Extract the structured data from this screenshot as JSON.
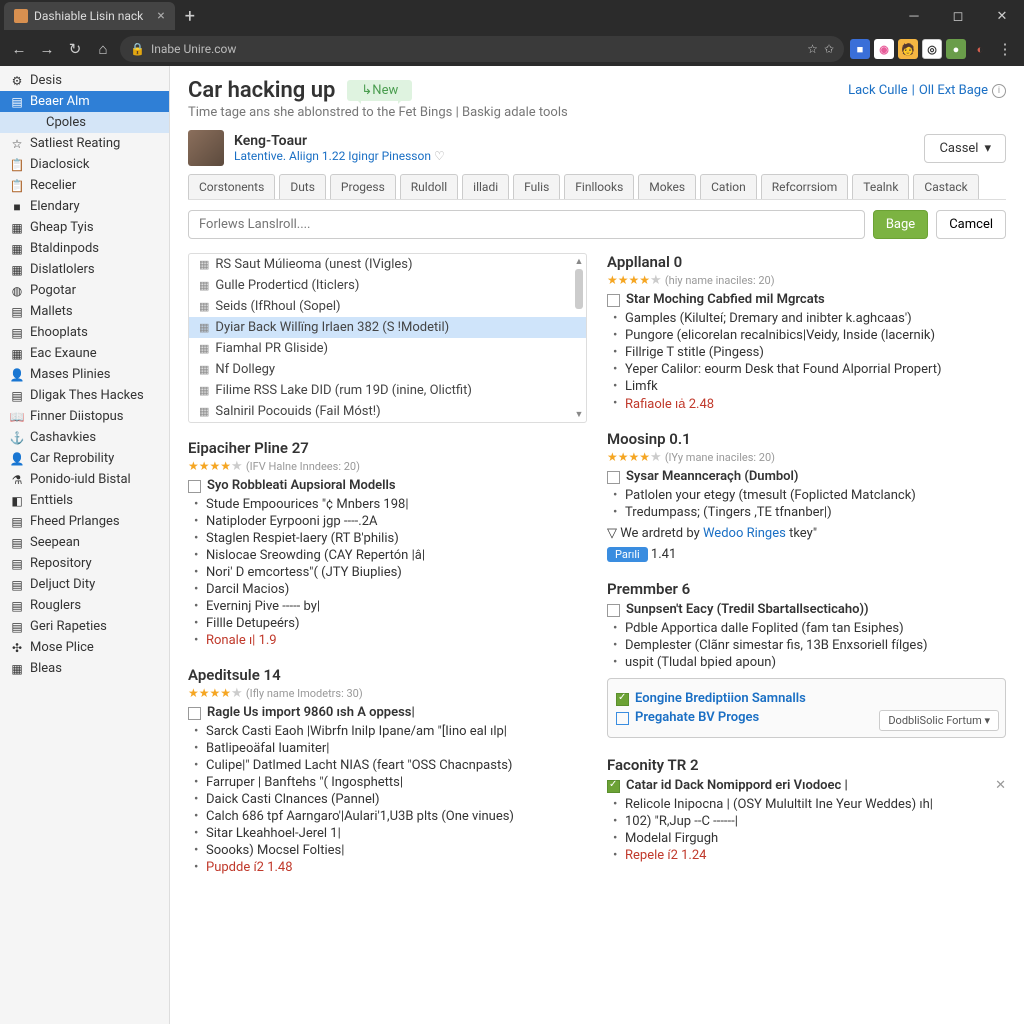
{
  "browser": {
    "tab_title": "Dashiable Lisin nack",
    "url": "Inabe Unire.cow",
    "ext_colors": [
      "#3a6fd8",
      "#e85d9a",
      "#f5b642",
      "#fff",
      "#6a9d4a",
      "#d8604f"
    ]
  },
  "sidebar": {
    "items": [
      {
        "icon": "⚙",
        "label": "Desis"
      },
      {
        "icon": "▤",
        "label": "Beaer Alm",
        "active": true
      },
      {
        "icon": "",
        "label": "Cpoles",
        "sub": true
      },
      {
        "icon": "☆",
        "label": "Satliest Reating"
      },
      {
        "icon": "📋",
        "label": "Diaclosick"
      },
      {
        "icon": "📋",
        "label": "Recelier"
      },
      {
        "icon": "■",
        "label": "Elendary"
      },
      {
        "icon": "▦",
        "label": "Gheap Tyis"
      },
      {
        "icon": "▦",
        "label": "Btaldinpods"
      },
      {
        "icon": "▦",
        "label": "Dislatlolers"
      },
      {
        "icon": "◍",
        "label": "Pogotar"
      },
      {
        "icon": "▤",
        "label": "Mallets"
      },
      {
        "icon": "▤",
        "label": "Ehooplats"
      },
      {
        "icon": "▦",
        "label": "Eac Exaune"
      },
      {
        "icon": "👤",
        "label": "Mases Plinies"
      },
      {
        "icon": "▤",
        "label": "Dligak Thes Hackes"
      },
      {
        "icon": "📖",
        "label": "Finner Diistopus"
      },
      {
        "icon": "⚓",
        "label": "Cashavkies"
      },
      {
        "icon": "👤",
        "label": "Car Reprobility"
      },
      {
        "icon": "⚗",
        "label": "Ponido-iuld Bistal"
      },
      {
        "icon": "◧",
        "label": "Enttiels"
      },
      {
        "icon": "▤",
        "label": "Fheed Prlanges"
      },
      {
        "icon": "▤",
        "label": "Seepean"
      },
      {
        "icon": "▤",
        "label": "Repository"
      },
      {
        "icon": "▤",
        "label": "Deljuct Dity"
      },
      {
        "icon": "▤",
        "label": "Rouglers"
      },
      {
        "icon": "▤",
        "label": "Geri Rapeties"
      },
      {
        "icon": "✣",
        "label": "Mose Plice"
      },
      {
        "icon": "▦",
        "label": "Bleas"
      }
    ]
  },
  "header": {
    "title": "Car hacking up",
    "badge": "↳New",
    "links": [
      "Lack Culle",
      "Oll Ext Bage"
    ],
    "subtitle": "Time tage ans she ablonstred to the Fet Bings | Baskig adale tools"
  },
  "author": {
    "name": "Keng-Toaur",
    "sub": "Latentive. Aliign 1.22 Igingr Pinesson",
    "dropdown": "Cassel"
  },
  "tabs": [
    "Corstonents",
    "Duts",
    "Progess",
    "Ruldoll",
    "illadi",
    "Fulis",
    "Finllooks",
    "Mokes",
    "Cation",
    "Refcorrsiom",
    "Tealnk",
    "Castack"
  ],
  "filter": {
    "placeholder": "Forlews Lanslroll....",
    "btn_page": "Bage",
    "btn_cancel": "Camcel"
  },
  "files": [
    "RS Saut Múlieoma (unest (IVigles)",
    "Gulle Proderticd (Iticlers)",
    "Seids (IfRhoul (Sopel)",
    "Dyiar Back Willïng Irlaen 382 (S !Modetil)",
    "Fiamhal PR Gliside)",
    "Nf Dollegy",
    "Filime RSS Lake DID (rum 19D (inine, Olictfit)",
    "Salniril Pocouids (Fail Móst!)"
  ],
  "left_sections": [
    {
      "title": "Eipaciher Pline 27",
      "meta": "(IFV Halne Inndees: 20)",
      "check": "Syo Robbleati Aupsioral Modells",
      "bullets": [
        {
          "t": "Stude Empoourices \"¢ Mnbers 198|"
        },
        {
          "t": "Natiploder Eyrpooni jgp ----.2A"
        },
        {
          "t": "Staglen Respiet-laery (RT B'philis)"
        },
        {
          "t": "Nislocae Sreowding (CAY Repertón |â|"
        },
        {
          "t": "Nori' D emcortess\"( (JTY Biuplies)"
        },
        {
          "t": "Darcil Macios)"
        },
        {
          "t": "Everninj Pive ----- by|"
        },
        {
          "t": "Fillle Detupeérs)"
        },
        {
          "t": "Ronale ı| 1.9",
          "red": true
        }
      ]
    },
    {
      "title": "Apeditsule 14",
      "meta": "(Ifly name Imodetrs: 30)",
      "check": "Ragle Us import 9860 ısh A oppess|",
      "bullets": [
        {
          "t": "Sarck Casti Eaoh |Wibrfn lnilp Ipane/am \"[Iino eal ılp|"
        },
        {
          "t": "Batlipeoäfal Iuamiter|"
        },
        {
          "t": "Culipe|\" Datlmed Lacht NIAS (feart \"OSS Chacnpasts)"
        },
        {
          "t": "Farruper | Banftehs \"( Ingosphetts|"
        },
        {
          "t": "Daick Casti Clnances (Pannel)"
        },
        {
          "t": "Calch 686 tpf Aarngaro'|Aulari'1,U3B plts (One vinues)"
        },
        {
          "t": "Sitar Lkeahhoel-Jerel 1|"
        },
        {
          "t": "Soooks) Mocsel Folties|"
        },
        {
          "t": "Pupdde í2 1.48",
          "red": true
        }
      ]
    }
  ],
  "right_sections": [
    {
      "title": "Appllanal 0",
      "meta": "(hiy name inaciles: 20)",
      "check": "Star Moching Cabfied mil Mgrcats",
      "bullets": [
        {
          "t": "Gamples (Kilulteí; Dremary and inibter k.aghcaas')"
        },
        {
          "t": "Pungore (elicorelan recalnibics|Veidy, Inside (lacernik)"
        },
        {
          "t": "Fillrige T stitle (Pingess)"
        },
        {
          "t": "Yeper Calilor: eourm Desk that Found Alporrial Propert)"
        },
        {
          "t": "Limfk"
        },
        {
          "t": "Rafiaole ıȧ 2.48",
          "red": true
        }
      ]
    },
    {
      "title": "Moosinp 0.1",
      "meta": "(lYy mane inaciles: 20)",
      "check": "Sysar Meannceraçh (Dumbol)",
      "bullets": [
        {
          "t": "Patlolen your etegy (tmesult (Foplicted Matclanck)"
        },
        {
          "t": "Tredumpass; (Tingers ,TE tfnanber|)"
        }
      ],
      "extra_line": {
        "pre": "▽ We ardretd by ",
        "link": "Wedoo Ringes",
        "post": " tkey\""
      },
      "pill": "Parıli",
      "pill_val": "1.41"
    },
    {
      "title": "Premmber 6",
      "check": "Sunpsen't Eacy (Tredil Sbartallsecticaho))",
      "bullets": [
        {
          "t": "Pdble Apportica dalle Foplited (fam tan Esiphes)"
        },
        {
          "t": "Demplester (Clãnr simestar fis, 13B Enxsoriell fílges)"
        },
        {
          "t": "uspit (Tludal bpied apoun)"
        }
      ],
      "card": {
        "l1": "Eongine Brediptiion Samnalls",
        "l2": "Pregahate BV Proges",
        "btn": "DodbliSolic Fortum"
      }
    },
    {
      "title": "Faconity TR 2",
      "check": "Catar id Dack Nomippord eri Vıodoec |",
      "checked": true,
      "bullets": [
        {
          "t": "Relicole Inipocna | (OSY Mulultilt Ine Yeur Weddes) ıh|"
        },
        {
          "t": "102) \"R,Jup --C ------|"
        },
        {
          "t": "Modelal Firgugh"
        },
        {
          "t": "Repele í2 1.24",
          "red": true
        }
      ]
    }
  ]
}
